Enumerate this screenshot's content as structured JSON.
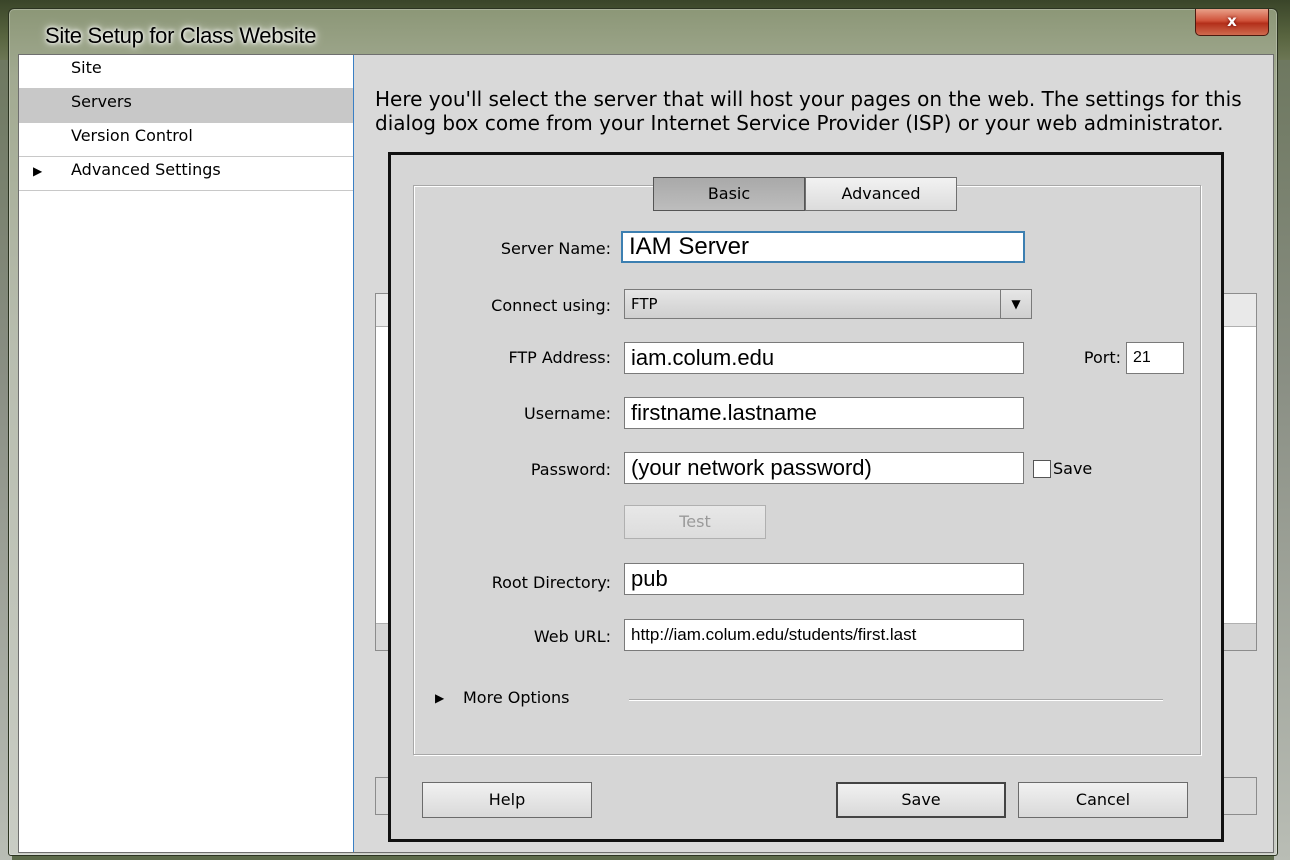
{
  "window": {
    "title": "Site Setup for Class Website",
    "close_glyph": "x"
  },
  "sidebar": {
    "items": [
      {
        "label": "Site"
      },
      {
        "label": "Servers",
        "selected": true
      },
      {
        "label": "Version Control"
      },
      {
        "label": "Advanced Settings",
        "expandable": true
      }
    ]
  },
  "main": {
    "intro": "Here you'll select the server that will host your pages on the web. The settings for this dialog box come from your Internet Service Provider (ISP) or your web administrator."
  },
  "server_dialog": {
    "tabs": [
      {
        "label": "Basic",
        "active": true
      },
      {
        "label": "Advanced"
      }
    ],
    "server_name": {
      "label": "Server Name:",
      "value": "IAM Server"
    },
    "connect_using": {
      "label": "Connect using:",
      "value": "FTP"
    },
    "ftp_address": {
      "label": "FTP Address:",
      "value": "iam.colum.edu"
    },
    "port": {
      "label": "Port:",
      "value": "21"
    },
    "username": {
      "label": "Username:",
      "value": "firstname.lastname"
    },
    "password": {
      "label": "Password:",
      "value": "(your network password)",
      "save_label": "Save",
      "save_checked": false
    },
    "test_button": "Test",
    "root_directory": {
      "label": "Root Directory:",
      "value": "pub"
    },
    "web_url": {
      "label": "Web URL:",
      "value": "http://iam.colum.edu/students/first.last"
    },
    "more_options": "More Options",
    "buttons": {
      "help": "Help",
      "save": "Save",
      "cancel": "Cancel"
    }
  }
}
